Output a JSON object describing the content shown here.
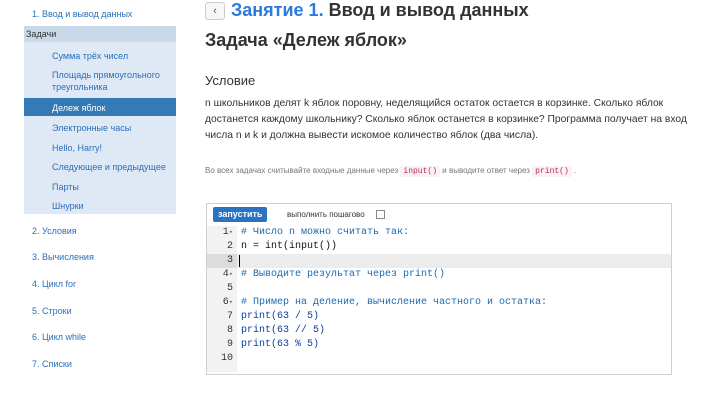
{
  "sidebar": {
    "top_link": "1. Ввод и вывод данных",
    "section_header": "Задачи",
    "sub_items": [
      "Сумма трёх чисел",
      "Площадь прямоугольного треугольника",
      "Дележ яблок",
      "Электронные часы",
      "Hello, Harry!",
      "Следующее и предыдущее",
      "Парты",
      "Шнурки"
    ],
    "active_sub_item": "Дележ яблок",
    "lessons": [
      "2. Условия",
      "3. Вычисления",
      "4. Цикл for",
      "5. Строки",
      "6. Цикл while",
      "7. Списки"
    ]
  },
  "header": {
    "back_icon": "chevron-left-icon",
    "back_glyph": "‹",
    "lesson_link": "Занятие 1.",
    "lesson_rest": " Ввод и вывод данных",
    "task_title": "Задача «Дележ яблок»"
  },
  "condition": {
    "heading": "Условие",
    "text": "n школьников делят k яблок поровну, неделящийся остаток остается в корзинке. Сколько яблок достанется каждому школьнику? Сколько яблок останется в корзинке? Программа получает на вход числа n и k и должна вывести искомое количество яблок (два числа)."
  },
  "hint": {
    "part1": "Во всех задачах считывайте входные данные через",
    "code1": "input()",
    "part2": "и выводите ответ через",
    "code2": "print()",
    "part3": "."
  },
  "editor": {
    "run_label": "запустить",
    "step_label": "выполнить пошагово",
    "step_checked": false,
    "active_line": 3,
    "lines": [
      {
        "n": "1",
        "fold": "▾",
        "text": "# Число n можно считать так:",
        "kind": "comment"
      },
      {
        "n": "2",
        "fold": "",
        "text": "n = int(input())",
        "kind": "plain"
      },
      {
        "n": "3",
        "fold": "",
        "text": "",
        "kind": "plain"
      },
      {
        "n": "4",
        "fold": "▾",
        "text": "# Выводите результат через print()",
        "kind": "comment"
      },
      {
        "n": "5",
        "fold": "",
        "text": "",
        "kind": "plain"
      },
      {
        "n": "6",
        "fold": "▾",
        "text": "# Пример на деление, вычисление частного и остатка:",
        "kind": "comment"
      },
      {
        "n": "7",
        "fold": "",
        "text": "print(63 / 5)",
        "kind": "builtin"
      },
      {
        "n": "8",
        "fold": "",
        "text": "print(63 // 5)",
        "kind": "builtin"
      },
      {
        "n": "9",
        "fold": "",
        "text": "print(63 % 5)",
        "kind": "builtin"
      },
      {
        "n": "10",
        "fold": "",
        "text": "",
        "kind": "plain"
      }
    ]
  },
  "colors": {
    "accent": "#337ab7",
    "link": "#2a6ebb",
    "submenu_bg": "#dfe9f5",
    "run_button": "#2a73c3"
  }
}
